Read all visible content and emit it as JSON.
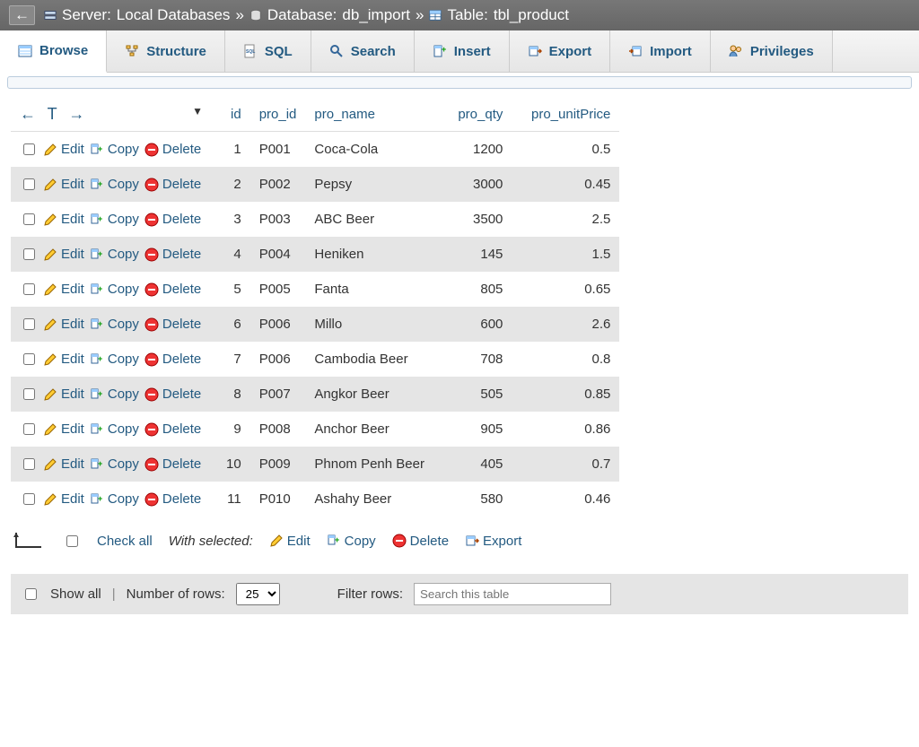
{
  "breadcrumb": {
    "server_label": "Server:",
    "server_name": "Local Databases",
    "sep": "»",
    "database_label": "Database:",
    "database_name": "db_import",
    "table_label": "Table:",
    "table_name": "tbl_product"
  },
  "tabs": {
    "browse": "Browse",
    "structure": "Structure",
    "sql": "SQL",
    "search": "Search",
    "insert": "Insert",
    "export": "Export",
    "import": "Import",
    "privileges": "Privileges"
  },
  "table": {
    "headers": {
      "id": "id",
      "pro_id": "pro_id",
      "pro_name": "pro_name",
      "pro_qty": "pro_qty",
      "pro_unitPrice": "pro_unitPrice"
    },
    "row_actions": {
      "edit": "Edit",
      "copy": "Copy",
      "delete": "Delete"
    },
    "rows": [
      {
        "id": "1",
        "pro_id": "P001",
        "pro_name": "Coca-Cola",
        "pro_qty": "1200",
        "pro_unitPrice": "0.5"
      },
      {
        "id": "2",
        "pro_id": "P002",
        "pro_name": "Pepsy",
        "pro_qty": "3000",
        "pro_unitPrice": "0.45"
      },
      {
        "id": "3",
        "pro_id": "P003",
        "pro_name": "ABC Beer",
        "pro_qty": "3500",
        "pro_unitPrice": "2.5"
      },
      {
        "id": "4",
        "pro_id": "P004",
        "pro_name": "Heniken",
        "pro_qty": "145",
        "pro_unitPrice": "1.5"
      },
      {
        "id": "5",
        "pro_id": "P005",
        "pro_name": "Fanta",
        "pro_qty": "805",
        "pro_unitPrice": "0.65"
      },
      {
        "id": "6",
        "pro_id": "P006",
        "pro_name": "Millo",
        "pro_qty": "600",
        "pro_unitPrice": "2.6"
      },
      {
        "id": "7",
        "pro_id": "P006",
        "pro_name": "Cambodia Beer",
        "pro_qty": "708",
        "pro_unitPrice": "0.8"
      },
      {
        "id": "8",
        "pro_id": "P007",
        "pro_name": "Angkor Beer",
        "pro_qty": "505",
        "pro_unitPrice": "0.85"
      },
      {
        "id": "9",
        "pro_id": "P008",
        "pro_name": "Anchor Beer",
        "pro_qty": "905",
        "pro_unitPrice": "0.86"
      },
      {
        "id": "10",
        "pro_id": "P009",
        "pro_name": "Phnom Penh Beer",
        "pro_qty": "405",
        "pro_unitPrice": "0.7"
      },
      {
        "id": "11",
        "pro_id": "P010",
        "pro_name": "Ashahy Beer",
        "pro_qty": "580",
        "pro_unitPrice": "0.46"
      }
    ]
  },
  "footer": {
    "check_all": "Check all",
    "with_selected": "With selected:",
    "edit": "Edit",
    "copy": "Copy",
    "delete": "Delete",
    "export": "Export"
  },
  "bottom": {
    "show_all": "Show all",
    "num_rows_label": "Number of rows:",
    "num_rows_value": "25",
    "filter_label": "Filter rows:",
    "filter_placeholder": "Search this table"
  }
}
